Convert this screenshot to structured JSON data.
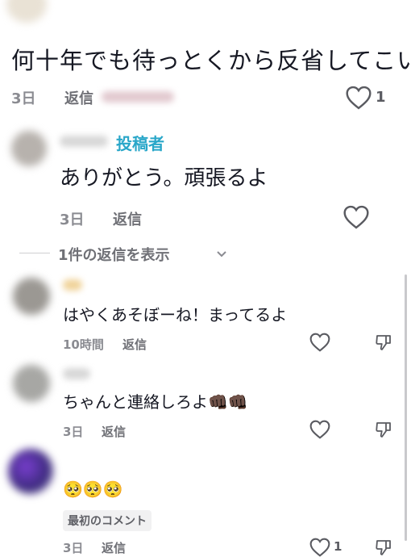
{
  "top_comment": {
    "text": "何十年でも待っとくから反省してこい",
    "time": "3日",
    "reply_label": "返信",
    "like_count": "1"
  },
  "author_reply": {
    "author_badge": "投稿者",
    "text": "ありがとう。頑張るよ",
    "time": "3日",
    "reply_label": "返信"
  },
  "view_replies": {
    "label": "1件の返信を表示"
  },
  "comments": [
    {
      "text": "はやくあそぼーね！まってるよ",
      "time": "10時間",
      "reply_label": "返信"
    },
    {
      "text": "ちゃんと連絡しろよ👊🏿👊🏿",
      "time": "3日",
      "reply_label": "返信"
    },
    {
      "text": "🥺🥺🥺",
      "badge": "最初のコメント",
      "time": "3日",
      "reply_label": "返信",
      "like_count": "1"
    }
  ],
  "colors": {
    "author_badge": "#2aa7c9",
    "muted": "#8a8b91",
    "text": "#161823"
  }
}
